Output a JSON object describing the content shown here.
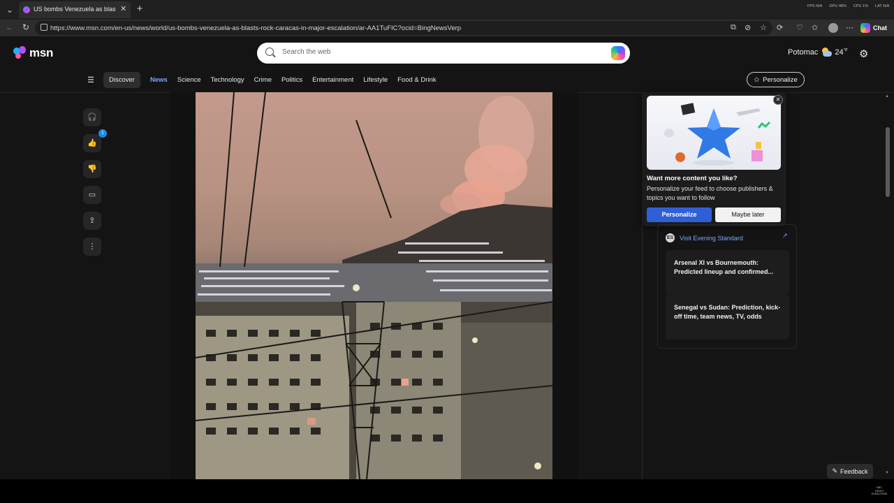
{
  "browser": {
    "tab_title": "US bombs Venezuela as blasts roc",
    "url": "https://www.msn.com/en-us/news/world/us-bombs-venezuela-as-blasts-rock-caracas-in-major-escalation/ar-AA1TuFIC?ocid=BingNewsVerp",
    "chat_label": "Chat",
    "perf": {
      "fps": "FPS N/A",
      "gpu": "GPU 48%",
      "cpu": "CPU 1%",
      "lat": "LAT N/A"
    }
  },
  "header": {
    "logo_text": "msn",
    "search_placeholder": "Search the web",
    "location": "Potomac",
    "temperature": "24",
    "temp_unit": "°F"
  },
  "nav": {
    "discover": "Discover",
    "items": [
      "News",
      "Science",
      "Technology",
      "Crime",
      "Politics",
      "Entertainment",
      "Lifestyle",
      "Food & Drink"
    ],
    "active": "News",
    "personalize_label": "Personalize"
  },
  "actions": {
    "like_count": "1"
  },
  "promo": {
    "title": "Want more content you like?",
    "body": "Personalize your feed to choose publishers & topics you want to follow",
    "primary_label": "Personalize",
    "secondary_label": "Maybe later"
  },
  "source_card": {
    "link_text": "Visit Evening Standard",
    "stories": [
      {
        "title": "Arsenal XI vs Bournemouth: Predicted lineup and confirmed..."
      },
      {
        "title": "Senegal vs Sudan: Prediction, kick-off time, team news, TV, odds"
      }
    ]
  },
  "feedback_label": "Feedback",
  "watermark": {
    "line1": "NBC",
    "line2": "NEWS",
    "line3": "SUBSCRIBE"
  },
  "colors": {
    "accent": "#79a6ff",
    "primary_button": "#2f5fd8",
    "badge": "#1e88e5"
  }
}
